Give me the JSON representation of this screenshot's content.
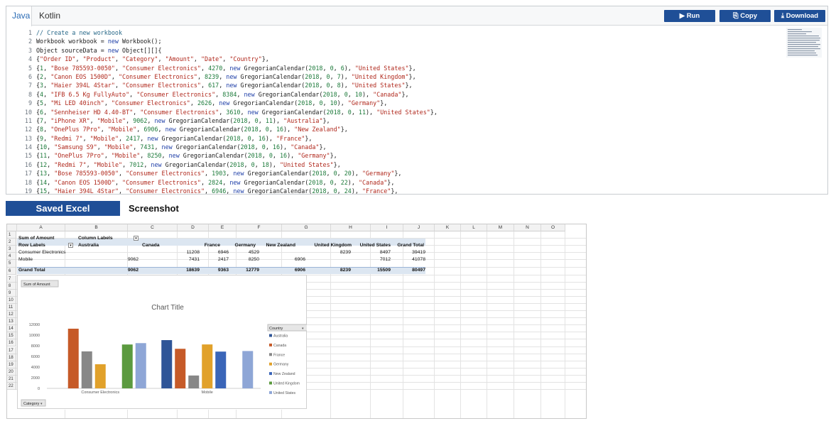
{
  "tabs": [
    "Java",
    "Kotlin"
  ],
  "buttons": {
    "run": "▶ Run",
    "copy": "⎘ Copy",
    "download": "⤓ Download"
  },
  "code_lines": [
    {
      "n": "1",
      "html": "<span class='cm'>// Create a new workbook</span>"
    },
    {
      "n": "2",
      "html": "Workbook workbook = <span class='kw'>new</span> Workbook();"
    },
    {
      "n": "3",
      "html": "Object sourceData = <span class='kw'>new</span> Object[][]{"
    },
    {
      "n": "4",
      "html": "{<span class='str'>\"Order ID\"</span>, <span class='str'>\"Product\"</span>, <span class='str'>\"Category\"</span>, <span class='str'>\"Amount\"</span>, <span class='str'>\"Date\"</span>, <span class='str'>\"Country\"</span>},"
    },
    {
      "n": "5",
      "html": "{<span class='num'>1</span>, <span class='str'>\"Bose 785593-0050\"</span>, <span class='str'>\"Consumer Electronics\"</span>, <span class='num'>4270</span>, <span class='kw'>new</span> GregorianCalendar(<span class='num'>2018</span>, <span class='num'>0</span>, <span class='num'>6</span>), <span class='str'>\"United States\"</span>},"
    },
    {
      "n": "6",
      "html": "{<span class='num'>2</span>, <span class='str'>\"Canon EOS 1500D\"</span>, <span class='str'>\"Consumer Electronics\"</span>, <span class='num'>8239</span>, <span class='kw'>new</span> GregorianCalendar(<span class='num'>2018</span>, <span class='num'>0</span>, <span class='num'>7</span>), <span class='str'>\"United Kingdom\"</span>},"
    },
    {
      "n": "7",
      "html": "{<span class='num'>3</span>, <span class='str'>\"Haier 394L 4Star\"</span>, <span class='str'>\"Consumer Electronics\"</span>, <span class='num'>617</span>, <span class='kw'>new</span> GregorianCalendar(<span class='num'>2018</span>, <span class='num'>0</span>, <span class='num'>8</span>), <span class='str'>\"United States\"</span>},"
    },
    {
      "n": "8",
      "html": "{<span class='num'>4</span>, <span class='str'>\"IFB 6.5 Kg FullyAuto\"</span>, <span class='str'>\"Consumer Electronics\"</span>, <span class='num'>8384</span>, <span class='kw'>new</span> GregorianCalendar(<span class='num'>2018</span>, <span class='num'>0</span>, <span class='num'>10</span>), <span class='str'>\"Canada\"</span>},"
    },
    {
      "n": "9",
      "html": "{<span class='num'>5</span>, <span class='str'>\"Mi LED 40inch\"</span>, <span class='str'>\"Consumer Electronics\"</span>, <span class='num'>2626</span>, <span class='kw'>new</span> GregorianCalendar(<span class='num'>2018</span>, <span class='num'>0</span>, <span class='num'>10</span>), <span class='str'>\"Germany\"</span>},"
    },
    {
      "n": "10",
      "html": "{<span class='num'>6</span>, <span class='str'>\"Sennheiser HD 4.40-BT\"</span>, <span class='str'>\"Consumer Electronics\"</span>, <span class='num'>3610</span>, <span class='kw'>new</span> GregorianCalendar(<span class='num'>2018</span>, <span class='num'>0</span>, <span class='num'>11</span>), <span class='str'>\"United States\"</span>},"
    },
    {
      "n": "11",
      "html": "{<span class='num'>7</span>, <span class='str'>\"iPhone XR\"</span>, <span class='str'>\"Mobile\"</span>, <span class='num'>9062</span>, <span class='kw'>new</span> GregorianCalendar(<span class='num'>2018</span>, <span class='num'>0</span>, <span class='num'>11</span>), <span class='str'>\"Australia\"</span>},"
    },
    {
      "n": "12",
      "html": "{<span class='num'>8</span>, <span class='str'>\"OnePlus 7Pro\"</span>, <span class='str'>\"Mobile\"</span>, <span class='num'>6906</span>, <span class='kw'>new</span> GregorianCalendar(<span class='num'>2018</span>, <span class='num'>0</span>, <span class='num'>16</span>), <span class='str'>\"New Zealand\"</span>},"
    },
    {
      "n": "13",
      "html": "{<span class='num'>9</span>, <span class='str'>\"Redmi 7\"</span>, <span class='str'>\"Mobile\"</span>, <span class='num'>2417</span>, <span class='kw'>new</span> GregorianCalendar(<span class='num'>2018</span>, <span class='num'>0</span>, <span class='num'>16</span>), <span class='str'>\"France\"</span>},"
    },
    {
      "n": "14",
      "html": "{<span class='num'>10</span>, <span class='str'>\"Samsung S9\"</span>, <span class='str'>\"Mobile\"</span>, <span class='num'>7431</span>, <span class='kw'>new</span> GregorianCalendar(<span class='num'>2018</span>, <span class='num'>0</span>, <span class='num'>16</span>), <span class='str'>\"Canada\"</span>},"
    },
    {
      "n": "15",
      "html": "{<span class='num'>11</span>, <span class='str'>\"OnePlus 7Pro\"</span>, <span class='str'>\"Mobile\"</span>, <span class='num'>8250</span>, <span class='kw'>new</span> GregorianCalendar(<span class='num'>2018</span>, <span class='num'>0</span>, <span class='num'>16</span>), <span class='str'>\"Germany\"</span>},"
    },
    {
      "n": "16",
      "html": "{<span class='num'>12</span>, <span class='str'>\"Redmi 7\"</span>, <span class='str'>\"Mobile\"</span>, <span class='num'>7012</span>, <span class='kw'>new</span> GregorianCalendar(<span class='num'>2018</span>, <span class='num'>0</span>, <span class='num'>18</span>), <span class='str'>\"United States\"</span>},"
    },
    {
      "n": "17",
      "html": "{<span class='num'>13</span>, <span class='str'>\"Bose 785593-0050\"</span>, <span class='str'>\"Consumer Electronics\"</span>, <span class='num'>1903</span>, <span class='kw'>new</span> GregorianCalendar(<span class='num'>2018</span>, <span class='num'>0</span>, <span class='num'>20</span>), <span class='str'>\"Germany\"</span>},"
    },
    {
      "n": "18",
      "html": "{<span class='num'>14</span>, <span class='str'>\"Canon EOS 1500D\"</span>, <span class='str'>\"Consumer Electronics\"</span>, <span class='num'>2824</span>, <span class='kw'>new</span> GregorianCalendar(<span class='num'>2018</span>, <span class='num'>0</span>, <span class='num'>22</span>), <span class='str'>\"Canada\"</span>},"
    },
    {
      "n": "19",
      "html": "{<span class='num'>15</span>, <span class='str'>\"Haier 394L 4Star\"</span>, <span class='str'>\"Consumer Electronics\"</span>, <span class='num'>6946</span>, <span class='kw'>new</span> GregorianCalendar(<span class='num'>2018</span>, <span class='num'>0</span>, <span class='num'>24</span>), <span class='str'>\"France\"</span>},"
    }
  ],
  "sections": {
    "saved": "Saved Excel",
    "shot": "Screenshot"
  },
  "sheet": {
    "columns": [
      "A",
      "B",
      "C",
      "D",
      "E",
      "F",
      "G",
      "H",
      "I",
      "J",
      "K",
      "L",
      "M",
      "N",
      "O"
    ],
    "rows": [
      "1",
      "2",
      "3",
      "4",
      "5",
      "6",
      "7",
      "8",
      "9",
      "10",
      "11",
      "12",
      "13",
      "14",
      "15",
      "16",
      "17",
      "18",
      "19",
      "20",
      "21",
      "22"
    ],
    "pivot": {
      "r1": {
        "a": "Sum of Amount",
        "b": "Column Labels"
      },
      "r2": {
        "a": "Row Labels",
        "b": "Australia",
        "c": "Canada",
        "d": "France",
        "e": "Germany",
        "f": "New Zealand",
        "g": "United Kingdom",
        "h": "United States",
        "i": "Grand Total"
      },
      "r3": {
        "a": "Consumer Electronics",
        "b": "",
        "c": "11208",
        "d": "6946",
        "e": "4529",
        "f": "",
        "g": "8239",
        "h": "8497",
        "i": "39419"
      },
      "r4": {
        "a": "Mobile",
        "b": "9062",
        "c": "7431",
        "d": "2417",
        "e": "8250",
        "f": "6906",
        "g": "",
        "h": "7012",
        "i": "41078"
      },
      "r5": {
        "a": "Grand Total",
        "b": "9062",
        "c": "18639",
        "d": "9363",
        "e": "12779",
        "f": "6906",
        "g": "8239",
        "h": "15509",
        "i": "80497"
      }
    }
  },
  "chart_data": {
    "type": "bar",
    "title": "Chart Title",
    "field_button": "Sum of Amount",
    "axis_button": "Category",
    "legend_title": "Country",
    "legend_position": "right",
    "categories": [
      "Consumer Electronics",
      "Mobile"
    ],
    "ylim": [
      0,
      12000
    ],
    "yticks": [
      "0",
      "2000",
      "4000",
      "6000",
      "8000",
      "10000",
      "12000"
    ],
    "grid": false,
    "series": [
      {
        "name": "Australia",
        "color": "#2f5597",
        "values": [
          0,
          9062
        ]
      },
      {
        "name": "Canada",
        "color": "#c65a28",
        "values": [
          11208,
          7431
        ]
      },
      {
        "name": "France",
        "color": "#878787",
        "values": [
          6946,
          2417
        ]
      },
      {
        "name": "Germany",
        "color": "#e1a12a",
        "values": [
          4529,
          8250
        ]
      },
      {
        "name": "New Zealand",
        "color": "#3a65b8",
        "values": [
          0,
          6906
        ]
      },
      {
        "name": "United Kingdom",
        "color": "#5b9a3f",
        "values": [
          8239,
          0
        ]
      },
      {
        "name": "United States",
        "color": "#8ea6d6",
        "values": [
          8497,
          7012
        ]
      }
    ]
  }
}
